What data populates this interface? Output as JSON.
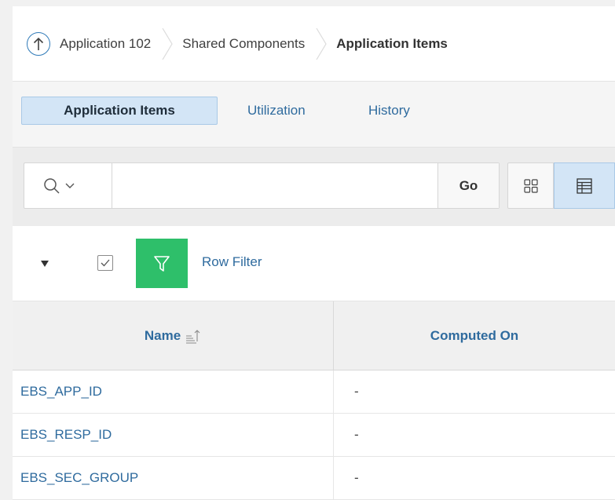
{
  "breadcrumb": {
    "items": [
      "Application 102",
      "Shared Components",
      "Application Items"
    ]
  },
  "tabs": [
    {
      "label": "Application Items",
      "active": true
    },
    {
      "label": "Utilization",
      "active": false
    },
    {
      "label": "History",
      "active": false
    }
  ],
  "toolbar": {
    "search_value": "",
    "go_label": "Go"
  },
  "filter": {
    "label": "Row Filter",
    "checked": true
  },
  "grid": {
    "columns": [
      "Name",
      "Computed On"
    ],
    "rows": [
      {
        "name": "EBS_APP_ID",
        "computed": "-"
      },
      {
        "name": "EBS_RESP_ID",
        "computed": "-"
      },
      {
        "name": "EBS_SEC_GROUP",
        "computed": "-"
      }
    ]
  },
  "colors": {
    "accent": "#2f6b9e",
    "active_tab_bg": "#d3e5f6",
    "filter_green": "#2ebf6a"
  }
}
